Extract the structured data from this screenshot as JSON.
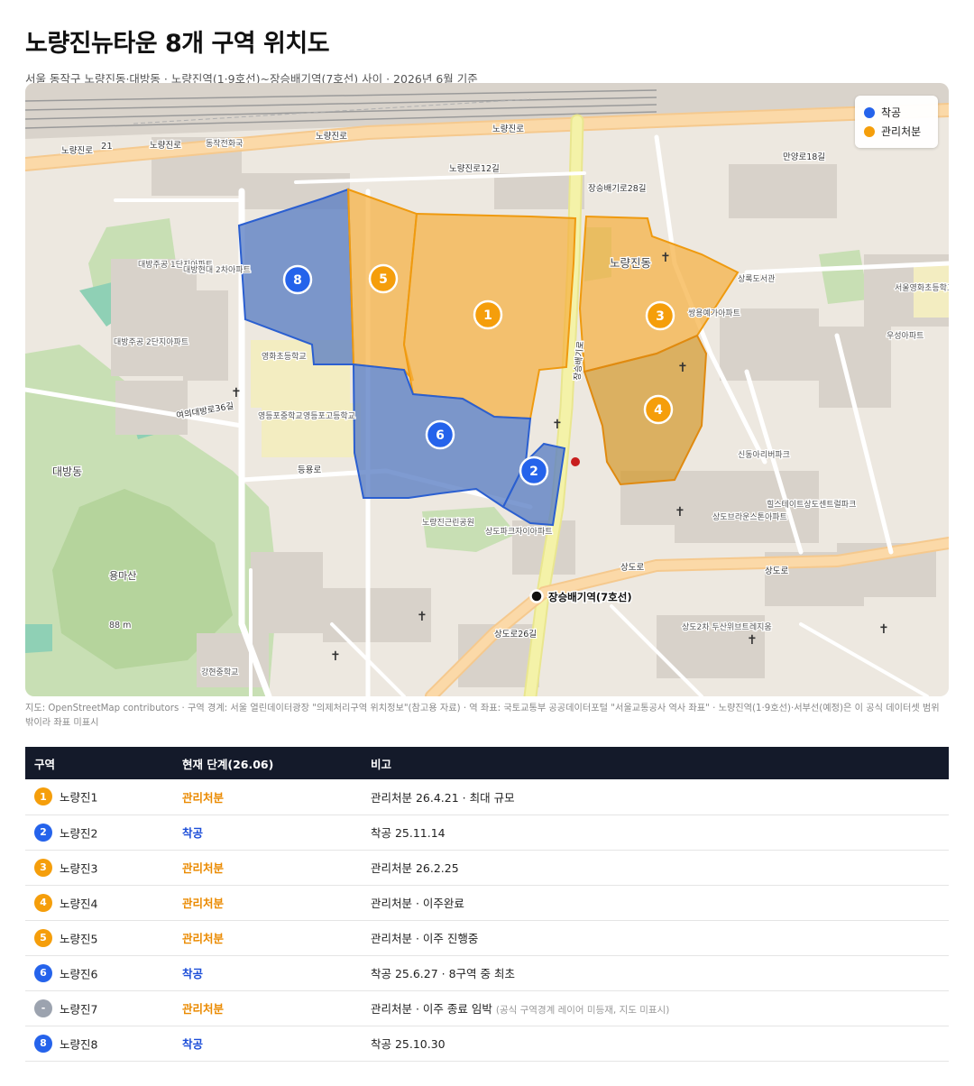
{
  "header": {
    "title": "노량진뉴타운 8개 구역 위치도",
    "subtitle": "서울 동작구 노량진동·대방동 · 노량진역(1·9호선)~장승배기역(7호선) 사이 · 2026년 6월 기준"
  },
  "legend": {
    "items": [
      {
        "label": "착공",
        "color": "#2563eb"
      },
      {
        "label": "관리처분",
        "color": "#f59e0b"
      }
    ]
  },
  "map": {
    "zone_markers": [
      "1",
      "2",
      "3",
      "4",
      "5",
      "6",
      "8"
    ],
    "station_label": "장승배기역(7호선)",
    "road_labels": [
      "노량진로",
      "노량진로",
      "노량진로",
      "노량진로",
      "상도로",
      "상도로",
      "장승배기로",
      "등용로",
      "여의대방로36길",
      "노량진로12길",
      "장승배기로28길",
      "만양로18길",
      "노량진동",
      "대방동",
      "용마산",
      "88 m",
      "상도로26길",
      "21"
    ],
    "poi_labels": [
      "영화초등학교",
      "영등포중학교",
      "영등포고등학교",
      "대방주공 1단지아파트",
      "대방주공 2단지아파트",
      "대방현대 2차아파트",
      "신동아리버파크",
      "쌍용예가아파트",
      "강현중학교",
      "노량진근린공원",
      "상도파크자이아파트",
      "동작전화국",
      "상도2차 두산위브트레지움",
      "상록도서관",
      "우성아파트",
      "서울영화초등학교",
      "상도브라운스톤아파트",
      "힐스테이트상도센트럴파크"
    ]
  },
  "source_note": "지도: OpenStreetMap contributors · 구역 경계: 서울 열린데이터광장 \"의제처리구역 위치정보\"(참고용 자료) · 역 좌표: 국토교통부 공공데이터포털 \"서울교통공사 역사 좌표\" · 노량진역(1·9호선)·서부선(예정)은 이 공식 데이터셋 범위 밖이라 좌표 미표시",
  "table": {
    "headers": [
      "구역",
      "현재 단계(26.06)",
      "비고"
    ],
    "rows": [
      {
        "num": "1",
        "name": "노량진1",
        "stage": "관리처분",
        "stage_color": "#ea8a00",
        "badge_color": "#f59e0b",
        "note": "관리처분 26.4.21 · 최대 규모",
        "note_sub": ""
      },
      {
        "num": "2",
        "name": "노량진2",
        "stage": "착공",
        "stage_color": "#1d4ed8",
        "badge_color": "#2563eb",
        "note": "착공 25.11.14",
        "note_sub": ""
      },
      {
        "num": "3",
        "name": "노량진3",
        "stage": "관리처분",
        "stage_color": "#ea8a00",
        "badge_color": "#f59e0b",
        "note": "관리처분 26.2.25",
        "note_sub": ""
      },
      {
        "num": "4",
        "name": "노량진4",
        "stage": "관리처분",
        "stage_color": "#ea8a00",
        "badge_color": "#f59e0b",
        "note": "관리처분 · 이주완료",
        "note_sub": ""
      },
      {
        "num": "5",
        "name": "노량진5",
        "stage": "관리처분",
        "stage_color": "#ea8a00",
        "badge_color": "#f59e0b",
        "note": "관리처분 · 이주 진행중",
        "note_sub": ""
      },
      {
        "num": "6",
        "name": "노량진6",
        "stage": "착공",
        "stage_color": "#1d4ed8",
        "badge_color": "#2563eb",
        "note": "착공 25.6.27 · 8구역 중 최초",
        "note_sub": ""
      },
      {
        "num": "-",
        "name": "노량진7",
        "stage": "관리처분",
        "stage_color": "#ea8a00",
        "badge_color": "#9ca3af",
        "note": "관리처분 · 이주 종료 임박",
        "note_sub": "(공식 구역경계 레이어 미등재, 지도 미표시)"
      },
      {
        "num": "8",
        "name": "노량진8",
        "stage": "착공",
        "stage_color": "#1d4ed8",
        "badge_color": "#2563eb",
        "note": "착공 25.10.30",
        "note_sub": ""
      }
    ]
  }
}
